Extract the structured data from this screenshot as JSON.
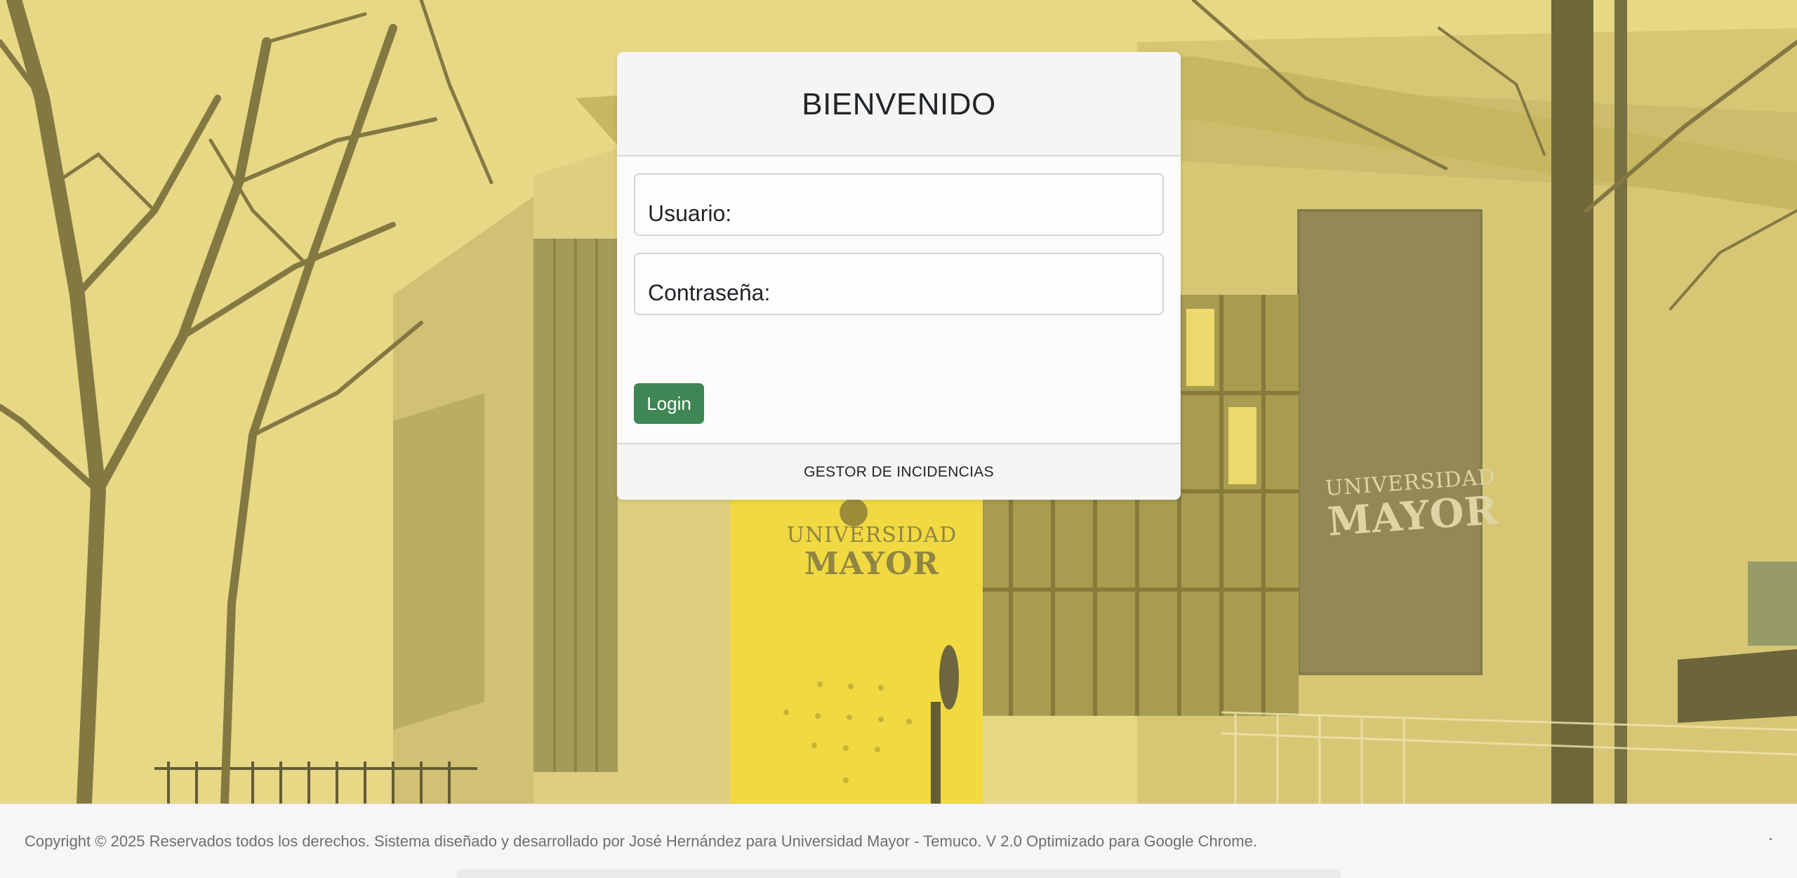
{
  "background": {
    "sign_front_line1": "UNIVERSIDAD",
    "sign_front_line2": "MAYOR",
    "sign_side_line1": "UNIVERSIDAD",
    "sign_side_line2": "MAYOR"
  },
  "login": {
    "title": "BIENVENIDO",
    "username": {
      "value": "",
      "placeholder": "Usuario:"
    },
    "password": {
      "value": "",
      "placeholder": "Contraseña:"
    },
    "submit_label": "Login",
    "footer_text": "GESTOR DE INCIDENCIAS"
  },
  "footer": {
    "copyright": "Copyright © 2025 Reservados todos los derechos. Sistema diseñado y desarrollado por José Hernández para Universidad Mayor - Temuco. V 2.0 Optimizado para Google Chrome."
  },
  "colors": {
    "login_button": "#3f8655",
    "card_header": "#f5f5f5",
    "background_tint": "#e8dc96",
    "footer_background": "#f5f6f5"
  },
  "icons": [
    "footer-dot"
  ]
}
